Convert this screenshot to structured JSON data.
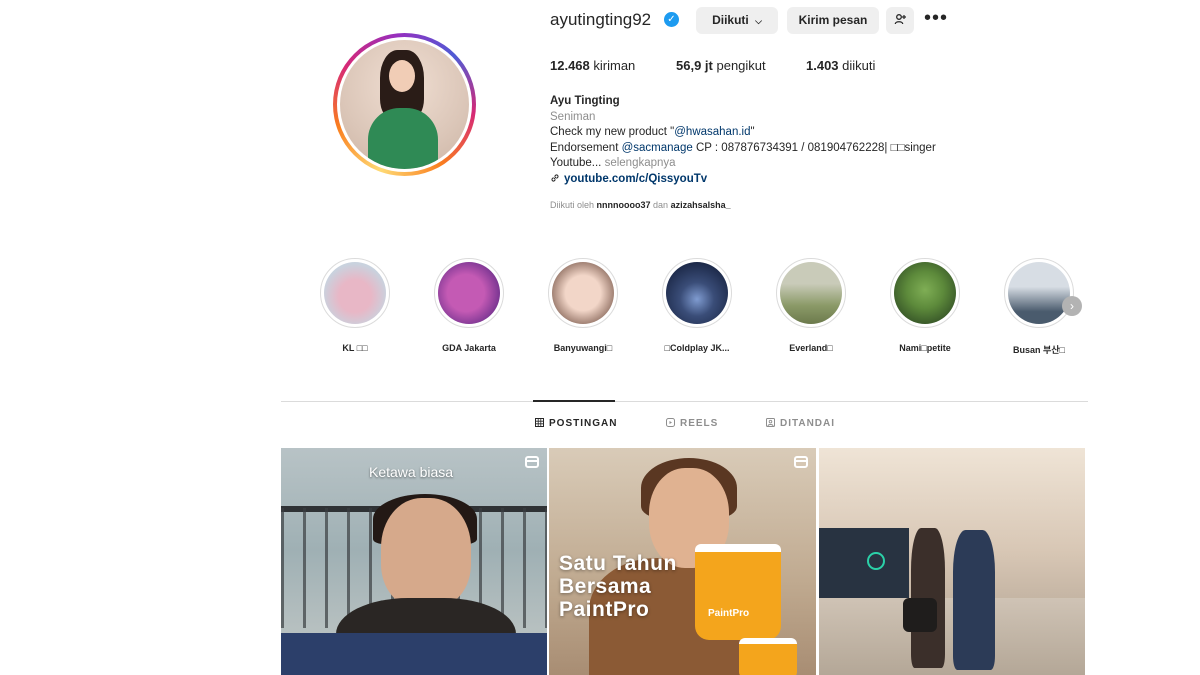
{
  "profile": {
    "username": "ayutingting92",
    "verified": true,
    "buttons": {
      "following": "Diikuti",
      "following_caret": "⌵",
      "message": "Kirim pesan",
      "suggest_icon": "add-user-icon",
      "more": "•••"
    },
    "stats": {
      "posts_value": "12.468",
      "posts_label": "kiriman",
      "followers_value": "56,9 jt",
      "followers_label": "pengikut",
      "following_value": "1.403",
      "following_label": "diikuti"
    },
    "bio": {
      "name": "Ayu Tingting",
      "category": "Seniman",
      "line1_text": "Check my new product \"",
      "line1_mention": "@hwasahan.id",
      "line1_end": "\"",
      "line2_prefix": "Endorsement ",
      "line2_mention": "@sacmanage",
      "line2_rest": " CP : 087876734391 / 081904762228| □□singer",
      "line3_text": "Youtube... ",
      "line3_more": "selengkapnya",
      "link_icon": "link-icon",
      "link": "youtube.com/c/QissyouTv"
    },
    "followed_by": {
      "prefix": "Diikuti oleh ",
      "user1": "nnnnoooo37",
      "joiner": " dan ",
      "user2": "azizahsalsha_"
    }
  },
  "highlights": [
    {
      "label": "KL □□",
      "color_a": "#e8b7c6",
      "color_b": "#c9d2de"
    },
    {
      "label": "GDA Jakarta",
      "color_a": "#c45ab4",
      "color_b": "#6d2f8c"
    },
    {
      "label": "Banyuwangi□",
      "color_a": "#f2d6c8",
      "color_b": "#7b5a4d"
    },
    {
      "label": "□Coldplay JK...",
      "color_a": "#1d2a4a",
      "color_b": "#7f9bd0"
    },
    {
      "label": "Everland□",
      "color_a": "#8b9a68",
      "color_b": "#c9cbb9"
    },
    {
      "label": "Nami□petite",
      "color_a": "#5d8a3b",
      "color_b": "#2f4b24"
    },
    {
      "label": "Busan 부산□",
      "color_a": "#d7dde4",
      "color_b": "#4a5b6d"
    }
  ],
  "highlights_next": "›",
  "tabs": {
    "posts": "POSTINGAN",
    "reels": "REELS",
    "tagged": "DITANDAI",
    "active": "posts"
  },
  "posts": [
    {
      "caption": "Ketawa biasa",
      "type": "reel"
    },
    {
      "headline_1": "Satu Tahun",
      "headline_2": "Bersama",
      "headline_3": "PaintPro",
      "brand": "PaintPro",
      "type": "reel"
    },
    {
      "type": "photo"
    }
  ],
  "colors": {
    "accent_link": "#00376b",
    "verified": "#1d9bf0",
    "muted": "#8e8e8e"
  }
}
